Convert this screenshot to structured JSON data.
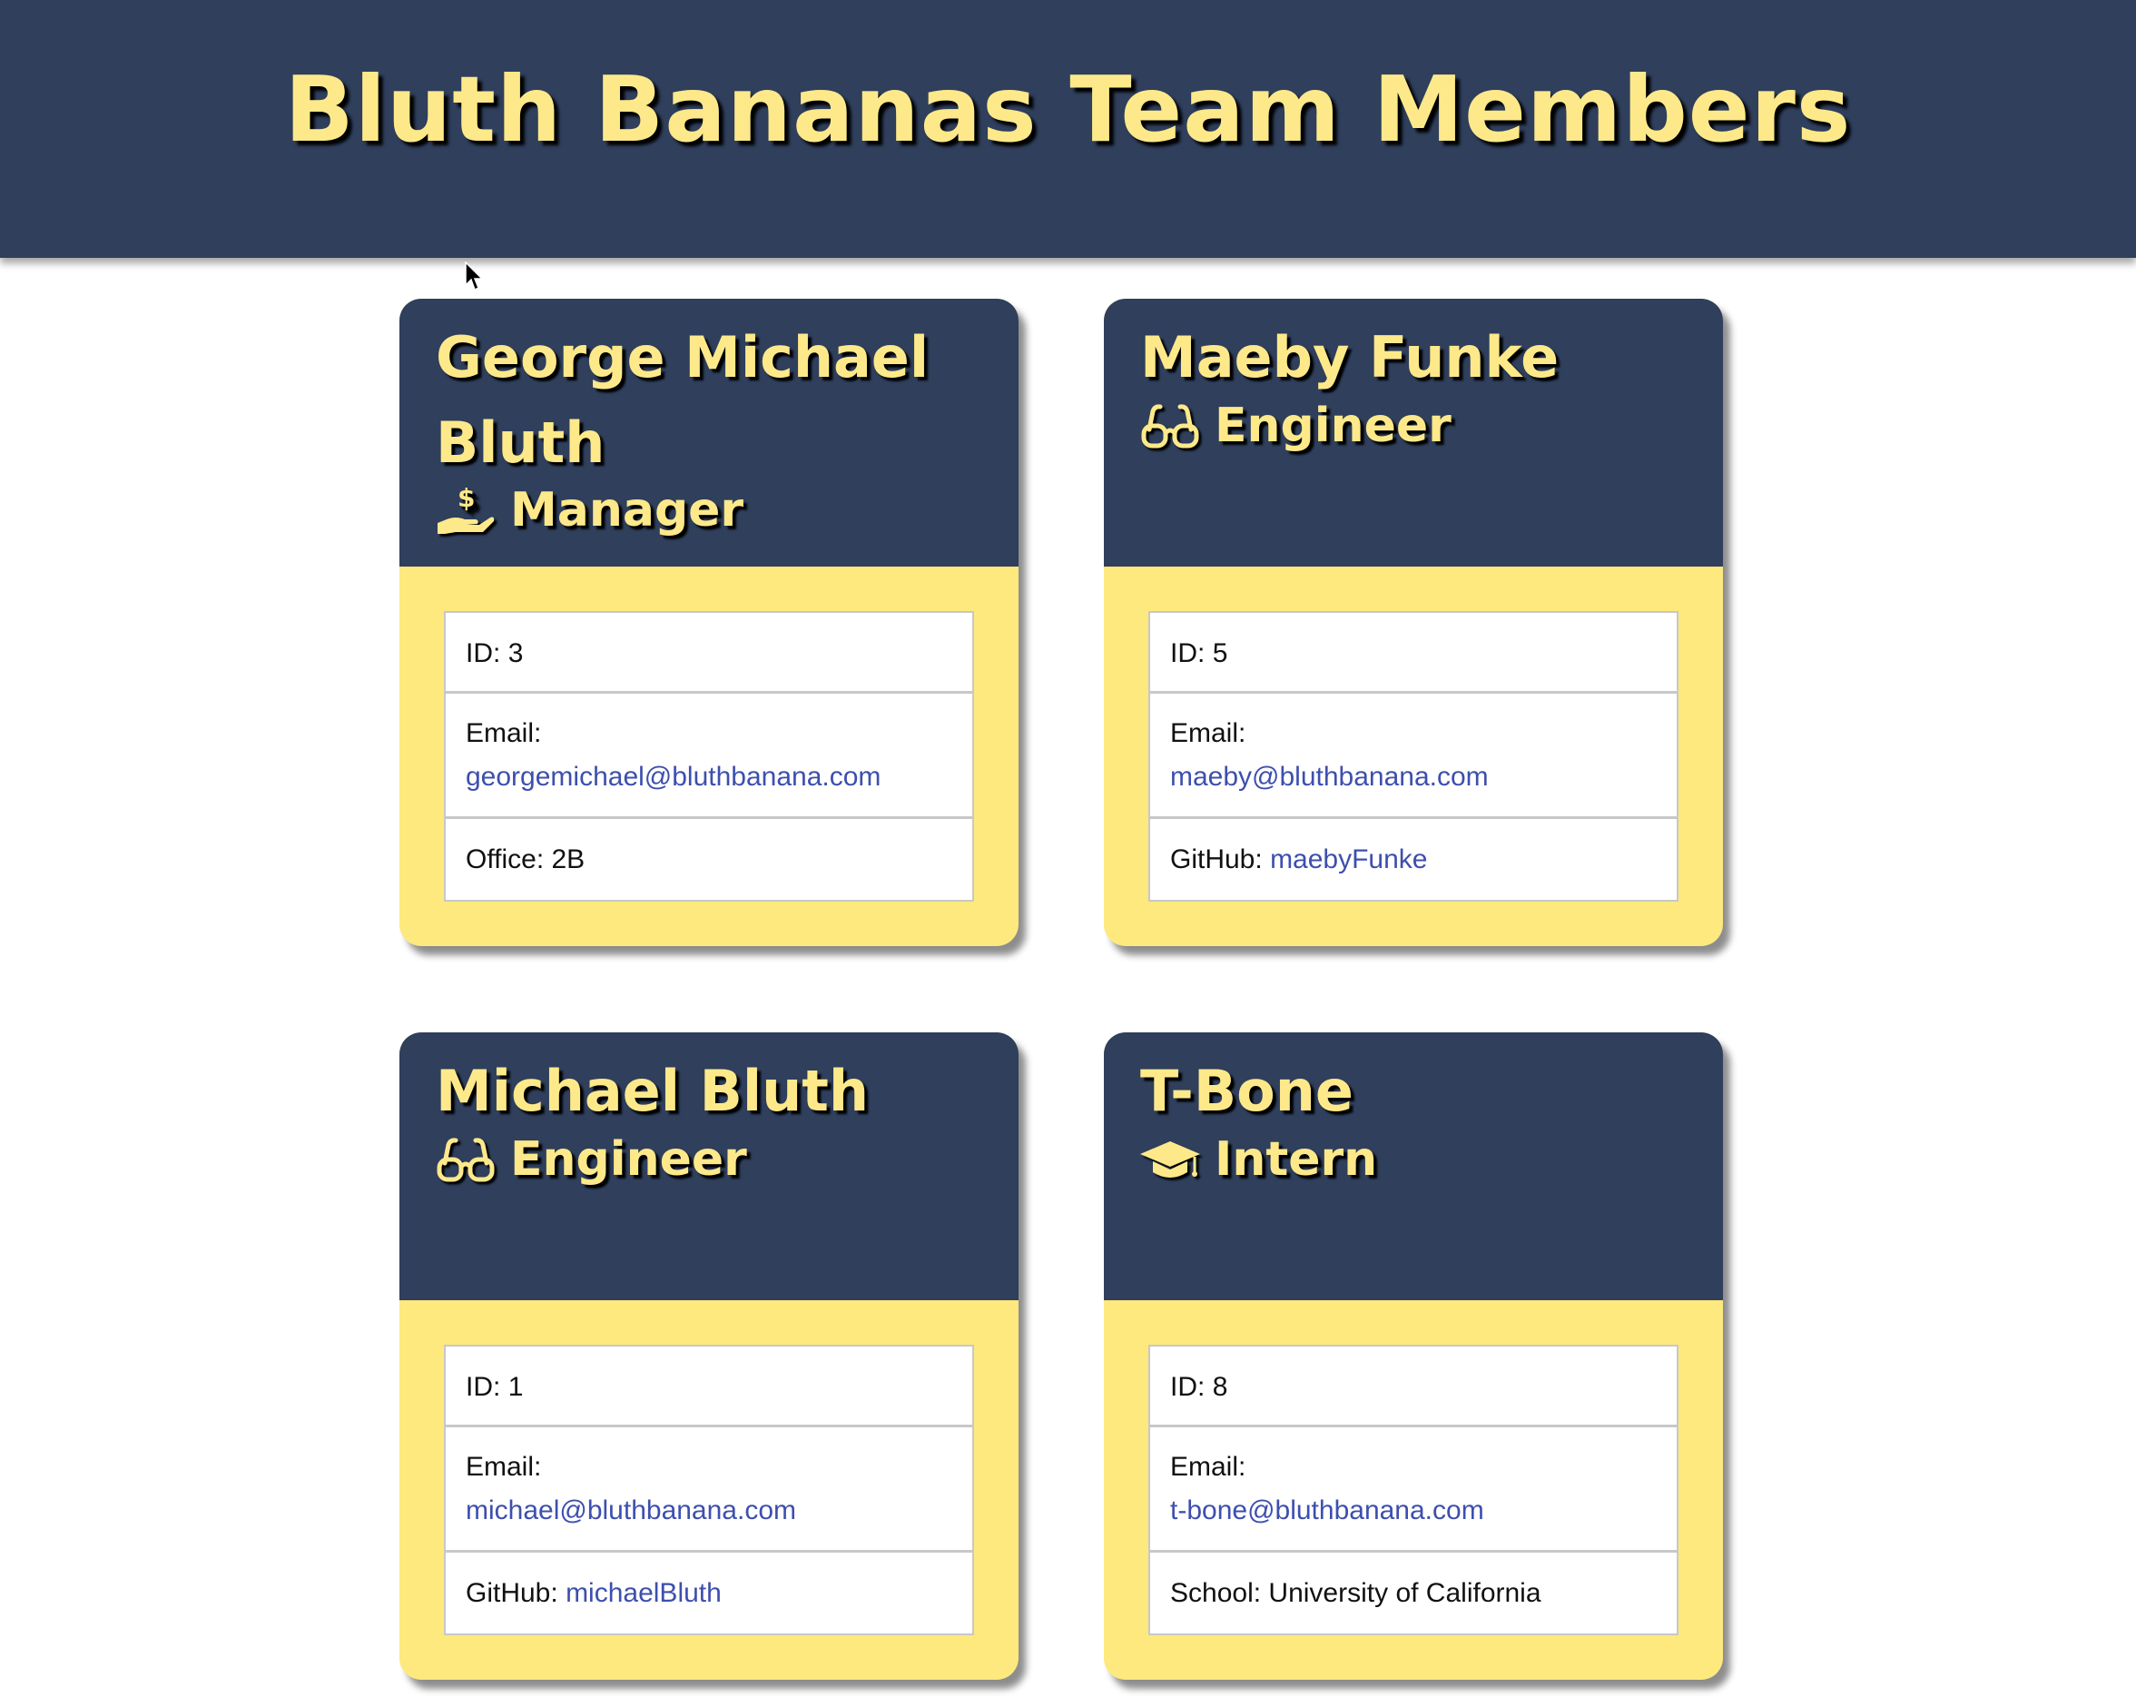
{
  "page": {
    "title": "Bluth Bananas Team Members"
  },
  "colors": {
    "navy": "#2f3f5c",
    "yellow": "#fde98a",
    "link": "#3d4fae"
  },
  "cards": [
    {
      "name": "George Michael Bluth",
      "role": "Manager",
      "role_icon": "hand-holding-usd-icon",
      "id_label": "ID:",
      "id": "3",
      "email_label": "Email:",
      "email": "georgemichael@bluthbanana.com",
      "extra_label": "Office:",
      "extra_value": "2B"
    },
    {
      "name": "Maeby Funke",
      "role": "Engineer",
      "role_icon": "glasses-icon",
      "id_label": "ID:",
      "id": "5",
      "email_label": "Email:",
      "email": "maeby@bluthbanana.com",
      "extra_label": "GitHub:",
      "extra_value": "maebyFunke"
    },
    {
      "name": "Michael Bluth",
      "role": "Engineer",
      "role_icon": "glasses-icon",
      "id_label": "ID:",
      "id": "1",
      "email_label": "Email:",
      "email": "michael@bluthbanana.com",
      "extra_label": "GitHub:",
      "extra_value": "michaelBluth"
    },
    {
      "name": "T-Bone",
      "role": "Intern",
      "role_icon": "graduation-cap-icon",
      "id_label": "ID:",
      "id": "8",
      "email_label": "Email:",
      "email": "t-bone@bluthbanana.com",
      "extra_label": "School:",
      "extra_value": "University of California"
    }
  ]
}
